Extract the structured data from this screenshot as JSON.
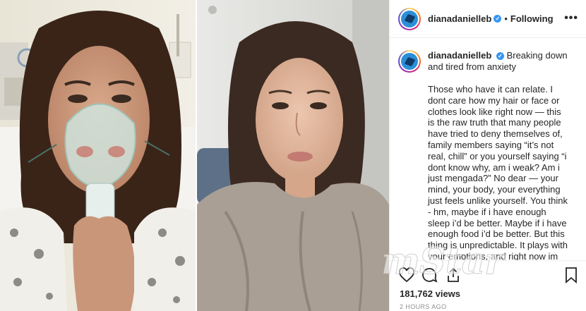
{
  "post": {
    "username": "dianadanielleb",
    "verified_mark": "✓",
    "separator": "•",
    "follow_status": "Following",
    "more_label": "•••",
    "caption_username": "dianadanielleb",
    "caption_title": "Breaking down and tired from anxiety",
    "caption_body": "Those who have it can relate. I dont care how my hair or face or clothes look like right now — this is the raw truth that many people have tried to deny themselves of, family members saying “it’s not real, chill” or you yourself saying “i dont know why, am i weak? Am i just mengada?” No dear — your mind, your body, your everything just feels unlike yourself. You think - hm, maybe if i have enough sleep i’d be better. Maybe if i have enough food i’d be better. But this thing is unpredictable. It plays with your emotions, and right now im tired. See I dont cry. I dont. Only when",
    "views": "181,762 views",
    "time": "2 HOURS AGO"
  },
  "watermark": {
    "text": "mStar"
  },
  "icons": [
    "heart-icon",
    "comment-icon",
    "share-icon",
    "bookmark-icon",
    "more-icon",
    "verified-badge-icon"
  ],
  "colors": {
    "accent": "#3897f0",
    "text": "#262626",
    "muted": "#8e8e8e",
    "border": "#efefef"
  }
}
